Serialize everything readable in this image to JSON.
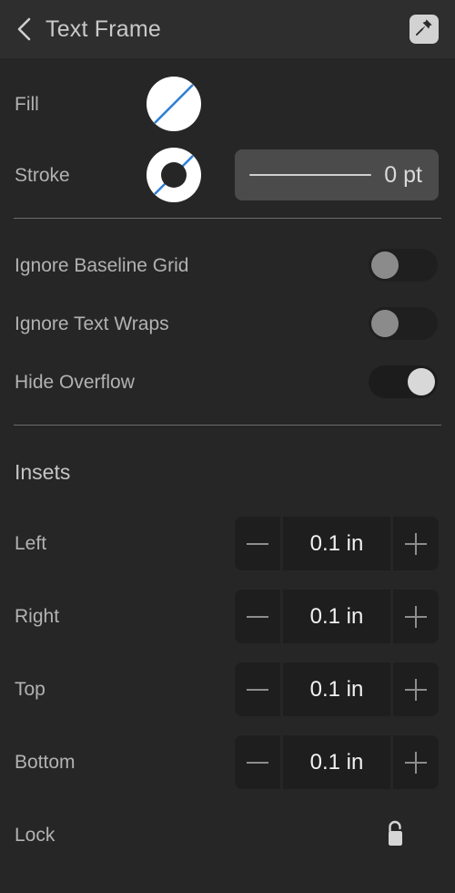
{
  "header": {
    "back_icon": "chevron-left-icon",
    "title": "Text Frame",
    "pin_icon": "pushpin-icon"
  },
  "appearance": {
    "fill": {
      "label": "Fill",
      "swatch_type": "none-fill-circle",
      "swatch_color": "#ffffff",
      "slash_color": "#2f7fd6"
    },
    "stroke": {
      "label": "Stroke",
      "swatch_type": "none-stroke-donut",
      "swatch_color": "#ffffff",
      "slash_color": "#2f7fd6",
      "width_value": "0 pt"
    }
  },
  "options": [
    {
      "label": "Ignore Baseline Grid",
      "state": "off"
    },
    {
      "label": "Ignore Text Wraps",
      "state": "off"
    },
    {
      "label": "Hide Overflow",
      "state": "on"
    }
  ],
  "insets": {
    "title": "Insets",
    "minus_icon": "minus-icon",
    "plus_icon": "plus-icon",
    "rows": [
      {
        "label": "Left",
        "value": "0.1 in"
      },
      {
        "label": "Right",
        "value": "0.1 in"
      },
      {
        "label": "Top",
        "value": "0.1 in"
      },
      {
        "label": "Bottom",
        "value": "0.1 in"
      }
    ]
  },
  "lock": {
    "label": "Lock",
    "icon": "unlocked-padlock-icon",
    "state": "unlocked"
  },
  "colors": {
    "background": "#262626",
    "header_background": "#2e2e2e",
    "label_text": "#b2b2b2",
    "value_text": "#f2f2f2",
    "field_background": "#1e1e1e",
    "divider": "#6c6c6c"
  }
}
